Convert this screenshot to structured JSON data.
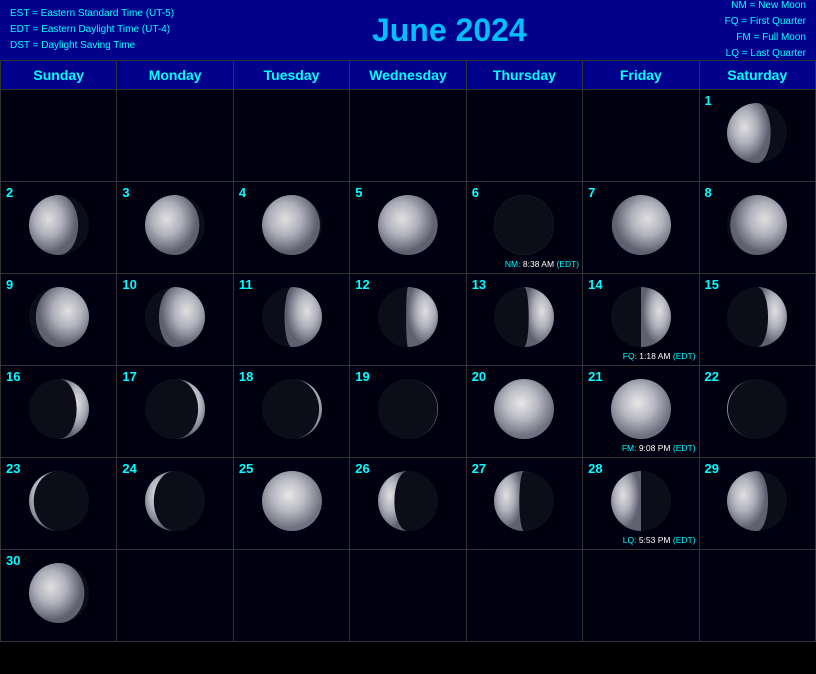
{
  "header": {
    "title": "June 2024",
    "left_lines": [
      "EST = Eastern Standard Time (UT-5)",
      "EDT = Eastern Daylight Time (UT-4)",
      "DST = Daylight Saving Time"
    ],
    "right_lines": [
      "NM = New Moon",
      "FQ = First Quarter",
      "FM = Full Moon",
      "LQ = Last Quarter"
    ]
  },
  "days_of_week": [
    "Sunday",
    "Monday",
    "Tuesday",
    "Wednesday",
    "Thursday",
    "Friday",
    "Saturday"
  ],
  "weeks": [
    [
      {
        "day": null,
        "phase": null
      },
      {
        "day": null,
        "phase": null
      },
      {
        "day": null,
        "phase": null
      },
      {
        "day": null,
        "phase": null
      },
      {
        "day": null,
        "phase": null
      },
      {
        "day": null,
        "phase": null
      },
      {
        "day": 1,
        "phase": "waning_crescent_large"
      }
    ],
    [
      {
        "day": 2,
        "phase": "waning_crescent_med"
      },
      {
        "day": 3,
        "phase": "waning_crescent_small"
      },
      {
        "day": 4,
        "phase": "waning_crescent_tiny"
      },
      {
        "day": 5,
        "phase": "new_almost"
      },
      {
        "day": 6,
        "phase": "new_moon",
        "event": "NM: 8:38 AM (EDT)"
      },
      {
        "day": 7,
        "phase": "waxing_crescent_tiny"
      },
      {
        "day": 8,
        "phase": "waxing_crescent_small"
      }
    ],
    [
      {
        "day": 9,
        "phase": "waxing_crescent_med"
      },
      {
        "day": 10,
        "phase": "waxing_crescent_large"
      },
      {
        "day": 11,
        "phase": "waxing_quarter_almost"
      },
      {
        "day": 12,
        "phase": "first_quarter_almost"
      },
      {
        "day": 13,
        "phase": "first_quarter_plus"
      },
      {
        "day": 14,
        "phase": "first_quarter",
        "event": "FQ: 1:18 AM (EDT)"
      },
      {
        "day": 15,
        "phase": "waxing_gibbous_small"
      }
    ],
    [
      {
        "day": 16,
        "phase": "waxing_gibbous_med"
      },
      {
        "day": 17,
        "phase": "waxing_gibbous_large"
      },
      {
        "day": 18,
        "phase": "waxing_gibbous_larger"
      },
      {
        "day": 19,
        "phase": "full_almost"
      },
      {
        "day": 20,
        "phase": "full_moon"
      },
      {
        "day": 21,
        "phase": "full_moon_bright",
        "event": "FM: 9:08 PM (EDT)"
      },
      {
        "day": 22,
        "phase": "waning_gibbous_small"
      }
    ],
    [
      {
        "day": 23,
        "phase": "waning_gibbous_med"
      },
      {
        "day": 24,
        "phase": "waning_gibbous_large"
      },
      {
        "day": 25,
        "phase": "full_waning"
      },
      {
        "day": 26,
        "phase": "waning_gibbous_plus"
      },
      {
        "day": 27,
        "phase": "third_quarter_almost"
      },
      {
        "day": 28,
        "phase": "last_quarter",
        "event": "LQ: 5:53 PM (EDT)"
      },
      {
        "day": 29,
        "phase": "waning_crescent_post"
      }
    ],
    [
      {
        "day": 30,
        "phase": "waning_crescent_end"
      },
      {
        "day": null,
        "phase": null
      },
      {
        "day": null,
        "phase": null
      },
      {
        "day": null,
        "phase": null
      },
      {
        "day": null,
        "phase": null
      },
      {
        "day": null,
        "phase": null
      },
      {
        "day": null,
        "phase": null
      }
    ]
  ]
}
